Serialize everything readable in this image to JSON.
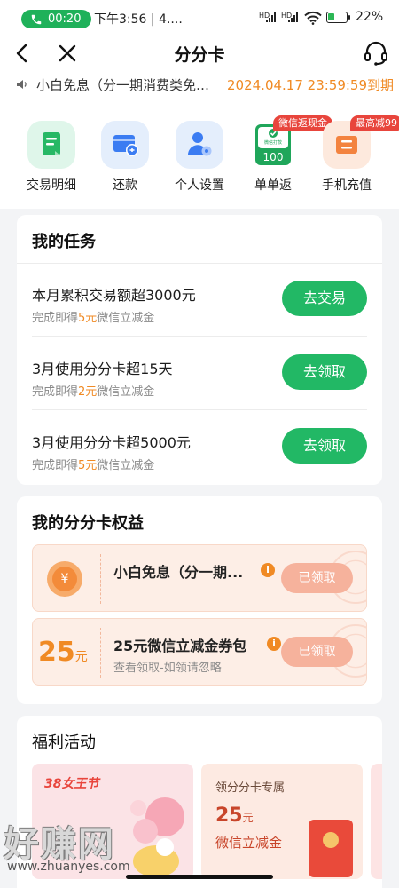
{
  "status_bar": {
    "call_time": "00:20",
    "time_text": "下午3:56 | 4....",
    "signal1": "HD",
    "signal2": "HD",
    "battery": "22%"
  },
  "nav": {
    "title": "分分卡"
  },
  "notice": {
    "text": "小白免息（分一期消费类免…",
    "deadline": "2024.04.17 23:59:59到期"
  },
  "quick_actions": [
    {
      "label": "交易明细",
      "icon": "transaction-detail-icon"
    },
    {
      "label": "还款",
      "icon": "repay-icon"
    },
    {
      "label": "个人设置",
      "icon": "personal-settings-icon"
    },
    {
      "label": "单单返",
      "icon": "cashback-icon",
      "badge": "微信返现金",
      "inner": "100",
      "inner_small": "微信打款"
    },
    {
      "label": "手机充值",
      "icon": "phone-topup-icon",
      "badge": "最高减99"
    }
  ],
  "tasks": {
    "title": "我的任务",
    "items": [
      {
        "title": "本月累积交易额超3000元",
        "sub_pre": "完成即得",
        "amount": "5元",
        "sub_post": "微信立减金",
        "button": "去交易"
      },
      {
        "title": "3月使用分分卡超15天",
        "sub_pre": "完成即得",
        "amount": "2元",
        "sub_post": "微信立减金",
        "button": "去领取"
      },
      {
        "title": "3月使用分分卡超5000元",
        "sub_pre": "完成即得",
        "amount": "5元",
        "sub_post": "微信立减金",
        "button": "去领取"
      }
    ]
  },
  "rights": {
    "title": "我的分分卡权益",
    "items": [
      {
        "icon_text": "¥",
        "title": "小白免息（分一期...",
        "subtitle": "",
        "button": "已领取"
      },
      {
        "amount": "25",
        "unit": "元",
        "title": "25元微信立减金券包",
        "subtitle": "查看领取-如领请忽略",
        "button": "已领取"
      }
    ]
  },
  "welfare": {
    "title": "福利活动",
    "cards": [
      {
        "tag": "38女王节"
      },
      {
        "heading": "领分分卡专属",
        "amount": "25",
        "unit": "元",
        "desc": "微信立减金"
      }
    ]
  },
  "watermark": {
    "text": "好赚网",
    "url": "www.zhuanyes.com"
  },
  "colors": {
    "accent_green": "#22b865",
    "accent_orange": "#f08a24",
    "badge_red": "#e8453c"
  }
}
